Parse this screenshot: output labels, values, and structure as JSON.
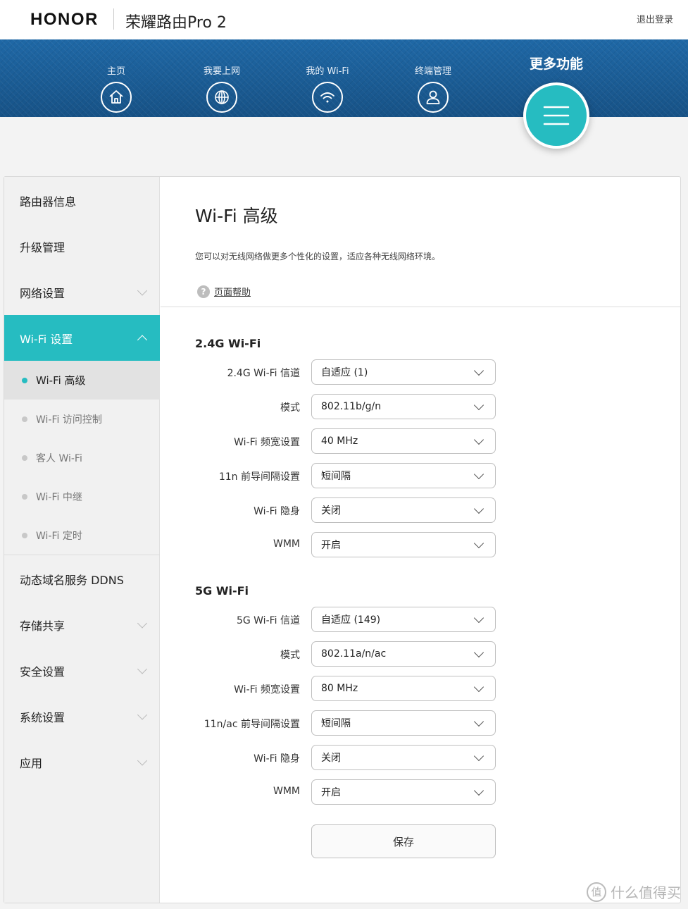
{
  "header": {
    "brand": "HONOR",
    "product": "荣耀路由Pro 2",
    "logout": "退出登录"
  },
  "nav": {
    "items": [
      {
        "label": "主页",
        "icon": "home-icon"
      },
      {
        "label": "我要上网",
        "icon": "globe-icon"
      },
      {
        "label": "我的 Wi-Fi",
        "icon": "wifi-icon"
      },
      {
        "label": "终端管理",
        "icon": "user-icon"
      }
    ],
    "more": {
      "label": "更多功能",
      "icon": "menu-icon"
    }
  },
  "sidebar": {
    "items": [
      {
        "label": "路由器信息"
      },
      {
        "label": "升级管理"
      },
      {
        "label": "网络设置"
      },
      {
        "label": "Wi-Fi 设置"
      },
      {
        "label": "动态域名服务 DDNS"
      },
      {
        "label": "存储共享"
      },
      {
        "label": "安全设置"
      },
      {
        "label": "系统设置"
      },
      {
        "label": "应用"
      }
    ],
    "subitems": [
      {
        "label": "Wi-Fi 高级"
      },
      {
        "label": "Wi-Fi 访问控制"
      },
      {
        "label": "客人 Wi-Fi"
      },
      {
        "label": "Wi-Fi 中继"
      },
      {
        "label": "Wi-Fi 定时"
      }
    ]
  },
  "page": {
    "title": "Wi-Fi 高级",
    "description": "您可以对无线网络做更多个性化的设置，适应各种无线网络环境。",
    "help": "页面帮助",
    "help_icon": "?",
    "save": "保存"
  },
  "wifi24": {
    "title": "2.4G Wi-Fi",
    "rows": [
      {
        "label": "2.4G Wi-Fi 信道",
        "value": "自适应 (1)"
      },
      {
        "label": "模式",
        "value": "802.11b/g/n"
      },
      {
        "label": "Wi-Fi 频宽设置",
        "value": "40 MHz"
      },
      {
        "label": "11n 前导间隔设置",
        "value": "短间隔"
      },
      {
        "label": "Wi-Fi 隐身",
        "value": "关闭"
      },
      {
        "label": "WMM",
        "value": "开启"
      }
    ]
  },
  "wifi5": {
    "title": "5G Wi-Fi",
    "rows": [
      {
        "label": "5G Wi-Fi 信道",
        "value": "自适应 (149)"
      },
      {
        "label": "模式",
        "value": "802.11a/n/ac"
      },
      {
        "label": "Wi-Fi 频宽设置",
        "value": "80 MHz"
      },
      {
        "label": "11n/ac 前导间隔设置",
        "value": "短间隔"
      },
      {
        "label": "Wi-Fi 隐身",
        "value": "关闭"
      },
      {
        "label": "WMM",
        "value": "开启"
      }
    ]
  },
  "watermark": {
    "text": "什么值得买",
    "icon_char": "值"
  },
  "colors": {
    "accent": "#26bcc1",
    "nav_bg": "#1d5b91"
  }
}
